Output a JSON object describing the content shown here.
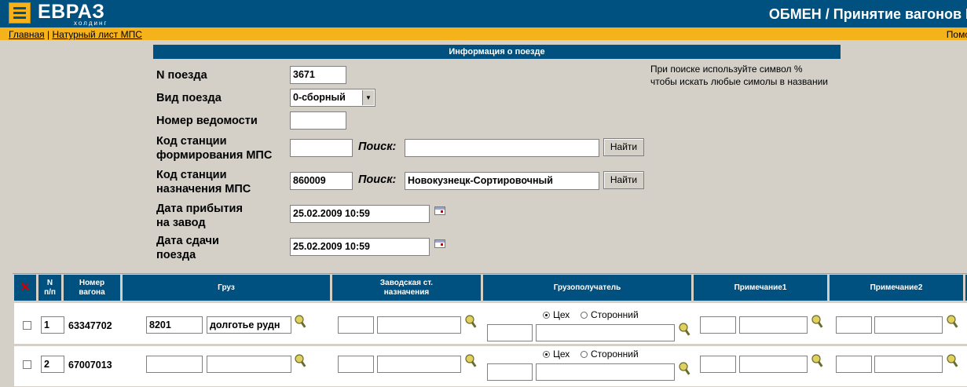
{
  "header": {
    "logo_text": "ЕВРАЗ",
    "logo_sub": "холдинг",
    "title": "ОБМЕН / Принятие вагонов МП"
  },
  "breadcrumbs": {
    "home": "Главная",
    "separator": "|",
    "current": "Натурный лист МПС",
    "help": "Помо"
  },
  "info_section": {
    "title": "Информация о поезде",
    "hint_line1": "При поиске используйте символ %",
    "hint_line2": "чтобы искать любые симолы в названии"
  },
  "form": {
    "train_number": {
      "label": "N поезда",
      "value": "3671"
    },
    "train_type": {
      "label": "Вид поезда",
      "value": "0-сборный"
    },
    "statement_number": {
      "label": "Номер ведомости",
      "value": ""
    },
    "origin_station": {
      "label_line1": "Код станции",
      "label_line2": "формирования МПС",
      "code": "",
      "search_label": "Поиск:",
      "search_value": "",
      "button": "Найти"
    },
    "dest_station": {
      "label_line1": "Код станции",
      "label_line2": "назначения МПС",
      "code": "860009",
      "search_label": "Поиск:",
      "search_value": "Новокузнецк-Сортировочный",
      "button": "Найти"
    },
    "arrival_date": {
      "label_line1": "Дата прибытия",
      "label_line2": "на завод",
      "value": "25.02.2009 10:59"
    },
    "handover_date": {
      "label_line1": "Дата сдачи",
      "label_line2": "поезда",
      "value": "25.02.2009 10:59"
    }
  },
  "table": {
    "columns": {
      "num_line1": "N",
      "num_line2": "п/п",
      "wagon_line1": "Номер",
      "wagon_line2": "вагона",
      "cargo": "Груз",
      "factory_line1": "Заводская ст.",
      "factory_line2": "назначения",
      "consignee": "Грузополучатель",
      "note1": "Примечание1",
      "note2": "Примечание2"
    },
    "rows": [
      {
        "num": "1",
        "wagon": "63347702",
        "cargo_code": "8201",
        "cargo_name": "долготье рудн",
        "consignee_option1": "Цех",
        "consignee_option2": "Сторонний"
      },
      {
        "num": "2",
        "wagon": "67007013",
        "cargo_code": "",
        "cargo_name": "",
        "consignee_option1": "Цех",
        "consignee_option2": "Сторонний"
      }
    ]
  },
  "colors": {
    "header_blue": "#00517f",
    "accent_yellow": "#f6b21a",
    "page_gray": "#d4d0c8",
    "delete_red": "#cc0000"
  },
  "icons": [
    "menu-icon",
    "calendar-icon",
    "lookup-icon",
    "delete-icon"
  ]
}
